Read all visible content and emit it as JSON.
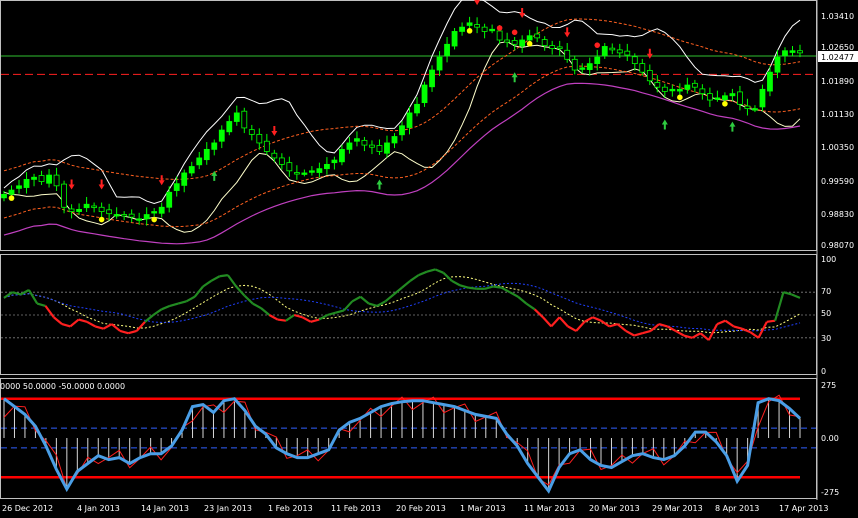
{
  "colors": {
    "background": "#000000",
    "frame": "#c0c0c0",
    "bull_candle": "#00ff00",
    "bear_candle": "#000000",
    "candle_outline": "#00ff00",
    "bb_outer": "#ffffcc",
    "bb_mid": "#ffffff",
    "dashed_env": "#ff6020",
    "magenta": "#c040c0",
    "level_green": "#30c030",
    "level_red": "#ff2020",
    "rsi_up": "#228b22",
    "rsi_down": "#ff2020",
    "rsi_signal": "#ffff80",
    "rsi_ma": "#2040ff",
    "cci_main": "#4a9ee6",
    "cci_signal": "#ff2020",
    "cci_level_red": "#ff0000",
    "cci_level_blue": "#3060ff",
    "arrow_up": "#2ecc40",
    "arrow_down": "#ff2020",
    "dot_yellow": "#ffff00",
    "dot_red": "#ff2020"
  },
  "price_panel": {
    "y_ticks": [
      "1.03410",
      "1.02650",
      "1.01890",
      "1.01130",
      "1.00350",
      "0.99590",
      "0.98830",
      "0.98070"
    ],
    "current_price_label": "1.02477",
    "current_price": 1.02477,
    "red_dashed_level": 1.0205
  },
  "rsi_panel": {
    "y_ticks": [
      "100",
      "70",
      "50",
      "30",
      "0"
    ],
    "levels": [
      70,
      50,
      30
    ]
  },
  "cci_panel": {
    "header": "0000 50.0000 -50.0000 0.0000",
    "y_ticks": [
      "275",
      "0.00",
      "-275"
    ],
    "levels_red": [
      200,
      -200
    ],
    "levels_blue": [
      50,
      -50
    ]
  },
  "x_axis": {
    "labels": [
      "26 Dec 2012",
      "4 Jan 2013",
      "14 Jan 2013",
      "23 Jan 2013",
      "1 Feb 2013",
      "11 Feb 2013",
      "20 Feb 2013",
      "1 Mar 2013",
      "11 Mar 2013",
      "20 Mar 2013",
      "29 Mar 2013",
      "8 Apr 2013",
      "17 Apr 2013"
    ]
  },
  "chart_data": {
    "type": "candlestick",
    "ohlc_close": [
      0.9925,
      0.9935,
      0.9945,
      0.996,
      0.9965,
      0.9955,
      0.997,
      0.9945,
      0.9895,
      0.9885,
      0.989,
      0.9902,
      0.9895,
      0.9885,
      0.988,
      0.9878,
      0.9875,
      0.9872,
      0.9868,
      0.9878,
      0.9885,
      0.9895,
      0.993,
      0.995,
      0.9975,
      0.999,
      1.001,
      1.003,
      1.0045,
      1.0075,
      1.0095,
      1.0115,
      1.008,
      1.0065,
      1.0045,
      1.0025,
      1.001,
      0.9995,
      0.998,
      0.9975,
      0.9975,
      0.998,
      0.9985,
      0.9995,
      1.0005,
      1.003,
      1.0045,
      1.0055,
      1.004,
      1.0035,
      1.0025,
      1.0045,
      1.006,
      1.0085,
      1.0115,
      1.0135,
      1.018,
      1.0215,
      1.0245,
      1.0275,
      1.0305,
      1.0315,
      1.0325,
      1.0315,
      1.0305,
      1.031,
      1.0285,
      1.028,
      1.0275,
      1.0285,
      1.0295,
      1.029,
      1.0272,
      1.0265,
      1.0265,
      1.024,
      1.0215,
      1.022,
      1.023,
      1.0245,
      1.027,
      1.0262,
      1.0255,
      1.025,
      1.023,
      1.021,
      1.019,
      1.0175,
      1.0165,
      1.017,
      1.017,
      1.018,
      1.0175,
      1.016,
      1.0145,
      1.015,
      1.0155,
      1.016,
      1.0135,
      1.0125,
      1.0125,
      1.017,
      1.021,
      1.0245,
      1.026,
      1.026,
      1.0255
    ],
    "rsi": [
      65,
      70,
      68,
      72,
      60,
      58,
      48,
      42,
      40,
      46,
      44,
      40,
      38,
      42,
      36,
      34,
      36,
      44,
      50,
      55,
      58,
      60,
      62,
      66,
      75,
      80,
      84,
      85,
      75,
      67,
      60,
      56,
      50,
      46,
      45,
      50,
      48,
      44,
      46,
      50,
      52,
      54,
      62,
      66,
      60,
      58,
      62,
      68,
      74,
      80,
      85,
      88,
      90,
      87,
      80,
      76,
      74,
      73,
      73,
      75,
      74,
      70,
      66,
      60,
      55,
      48,
      40,
      48,
      40,
      36,
      44,
      48,
      45,
      40,
      42,
      36,
      32,
      34,
      36,
      42,
      40,
      36,
      32,
      30,
      34,
      28,
      42,
      45,
      40,
      38,
      35,
      30,
      44,
      45,
      70,
      68,
      65
    ],
    "cci": [
      200,
      160,
      120,
      60,
      -40,
      -160,
      -260,
      -170,
      -130,
      -90,
      -110,
      -100,
      -130,
      -100,
      -80,
      -80,
      -40,
      40,
      160,
      170,
      130,
      190,
      200,
      140,
      60,
      20,
      -50,
      -80,
      -100,
      -100,
      -80,
      -60,
      40,
      80,
      100,
      130,
      160,
      175,
      185,
      190,
      190,
      180,
      170,
      160,
      140,
      120,
      110,
      100,
      20,
      -40,
      -130,
      -200,
      -270,
      -150,
      -80,
      -60,
      -110,
      -140,
      -150,
      -120,
      -90,
      -80,
      -100,
      -110,
      -90,
      -40,
      30,
      30,
      -20,
      -90,
      -220,
      -140,
      180,
      200,
      190,
      150,
      100
    ]
  }
}
